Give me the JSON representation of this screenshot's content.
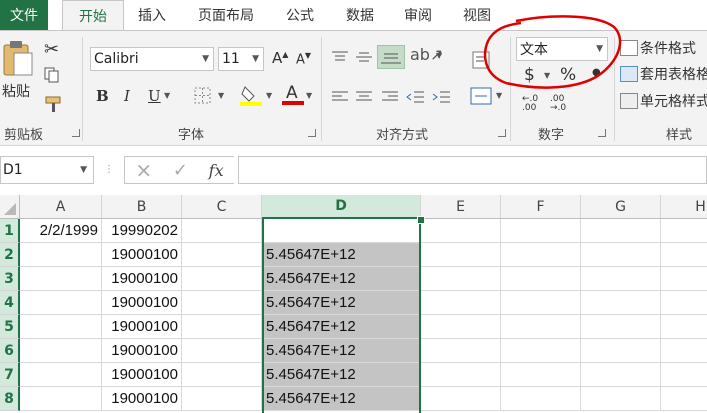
{
  "tabs": [
    "文件",
    "开始",
    "插入",
    "页面布局",
    "公式",
    "数据",
    "审阅",
    "视图"
  ],
  "ribbon": {
    "paste_label": "粘贴",
    "clipboard_group": "剪贴板",
    "font_name": "Calibri",
    "font_size": "11",
    "font_group": "字体",
    "bold": "B",
    "italic": "I",
    "underline": "U",
    "align_group": "对齐方式",
    "number_format": "文本",
    "currency_symbol": "$",
    "percent_symbol": "%",
    "number_group": "数字",
    "cond_format": "条件格式",
    "table_format": "套用表格格",
    "cell_style": "单元格样式",
    "styles_group": "样式",
    "accent_color": "#217346",
    "annotation_color": "#e00000"
  },
  "formula_bar": {
    "name_box": "D1",
    "fx": "fx",
    "cancel_icon": "×",
    "enter_icon": "✓",
    "content": ""
  },
  "columns": [
    "A",
    "B",
    "C",
    "D",
    "E",
    "F",
    "G",
    "H"
  ],
  "rows": [
    {
      "num": "1",
      "A": "2/2/1999",
      "B": "19990202",
      "D": ""
    },
    {
      "num": "2",
      "A": "",
      "B": "19000100",
      "D": "5.45647E+12"
    },
    {
      "num": "3",
      "A": "",
      "B": "19000100",
      "D": "5.45647E+12"
    },
    {
      "num": "4",
      "A": "",
      "B": "19000100",
      "D": "5.45647E+12"
    },
    {
      "num": "5",
      "A": "",
      "B": "19000100",
      "D": "5.45647E+12"
    },
    {
      "num": "6",
      "A": "",
      "B": "19000100",
      "D": "5.45647E+12"
    },
    {
      "num": "7",
      "A": "",
      "B": "19000100",
      "D": "5.45647E+12"
    },
    {
      "num": "8",
      "A": "",
      "B": "19000100",
      "D": "5.45647E+12"
    }
  ]
}
